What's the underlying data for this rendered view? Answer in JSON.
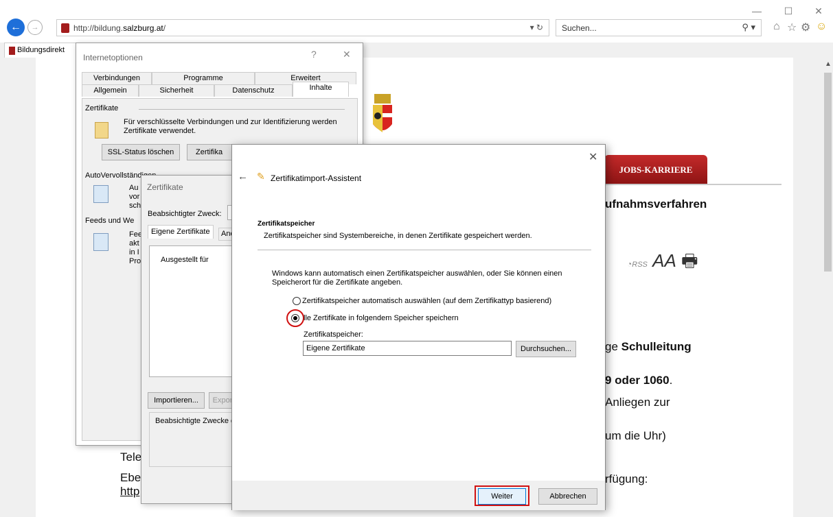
{
  "browser": {
    "url_prefix": "http://bildung.",
    "url_domain": "salzburg.at",
    "url_suffix": "/",
    "addr_controls": "▾ ↻",
    "search_placeholder": "Suchen...",
    "tab_title": "Bildungsdirekt"
  },
  "page": {
    "jobs_label": "JOBS-KARRIERE",
    "heading": "ufnahmsverfahren",
    "text_schulleitung_prefix": "ge ",
    "text_schulleitung_bold": "Schulleitung",
    "text_phone": "9 oder 1060",
    "text_phone_dot": ".",
    "text_anliegen": "Anliegen zur",
    "text_uhr": "um die Uhr)",
    "text_verfuegung": "rfügung:",
    "text_tele": "Tele",
    "text_ebe": "Ebe",
    "text_http": "http",
    "rss_label": "RSS",
    "font_label": "AA"
  },
  "internetoptionen": {
    "title": "Internetoptionen",
    "help": "?",
    "tabs_row1": [
      "Verbindungen",
      "Programme",
      "Erweitert"
    ],
    "tabs_row2": [
      "Allgemein",
      "Sicherheit",
      "Datenschutz",
      "Inhalte"
    ],
    "zertifikate_section": "Zertifikate",
    "zertifikate_desc": "Für verschlüsselte Verbindungen und zur Identifizierung werden Zertifikate verwendet.",
    "ssl_button": "SSL-Status löschen",
    "zert_button": "Zertifika",
    "autov_section": "AutoVervollständigen",
    "autov_text": "Au\nvor\nsch",
    "feeds_section": "Feeds und We",
    "feeds_text": "Fee\nakt\nin I\nPro"
  },
  "zertifikate_dialog": {
    "title": "Zertifikate",
    "zweck_label": "Beabsichtigter Zweck:",
    "tab_eigene": "Eigene Zertifikate",
    "tab_andere": "And",
    "col_ausgestellt": "Ausgestellt für",
    "import_button": "Importieren...",
    "export_button": "Expor",
    "zwecke_label": "Beabsichtigte Zwecke d"
  },
  "wizard": {
    "title": "Zertifikatimport-Assistent",
    "section_title": "Zertifikatspeicher",
    "section_desc": "Zertifikatspeicher sind Systembereiche, in denen Zertifikate gespeichert werden.",
    "intro": "Windows kann automatisch einen Zertifikatspeicher auswählen, oder Sie können einen Speicherort für die Zertifikate angeben.",
    "option_auto": "Zertifikatspeicher automatisch auswählen (auf dem Zertifikattyp basierend)",
    "option_manual": "lle Zertifikate in folgendem Speicher speichern",
    "option_manual_selected": true,
    "store_label": "Zertifikatspeicher:",
    "store_value": "Eigene Zertifikate",
    "browse_button": "Durchsuchen...",
    "next_button": "Weiter",
    "cancel_button": "Abbrechen"
  },
  "colors": {
    "accent_red": "#d01010",
    "jobs_red": "#a81e1e",
    "ie_blue": "#1e6fd9"
  }
}
